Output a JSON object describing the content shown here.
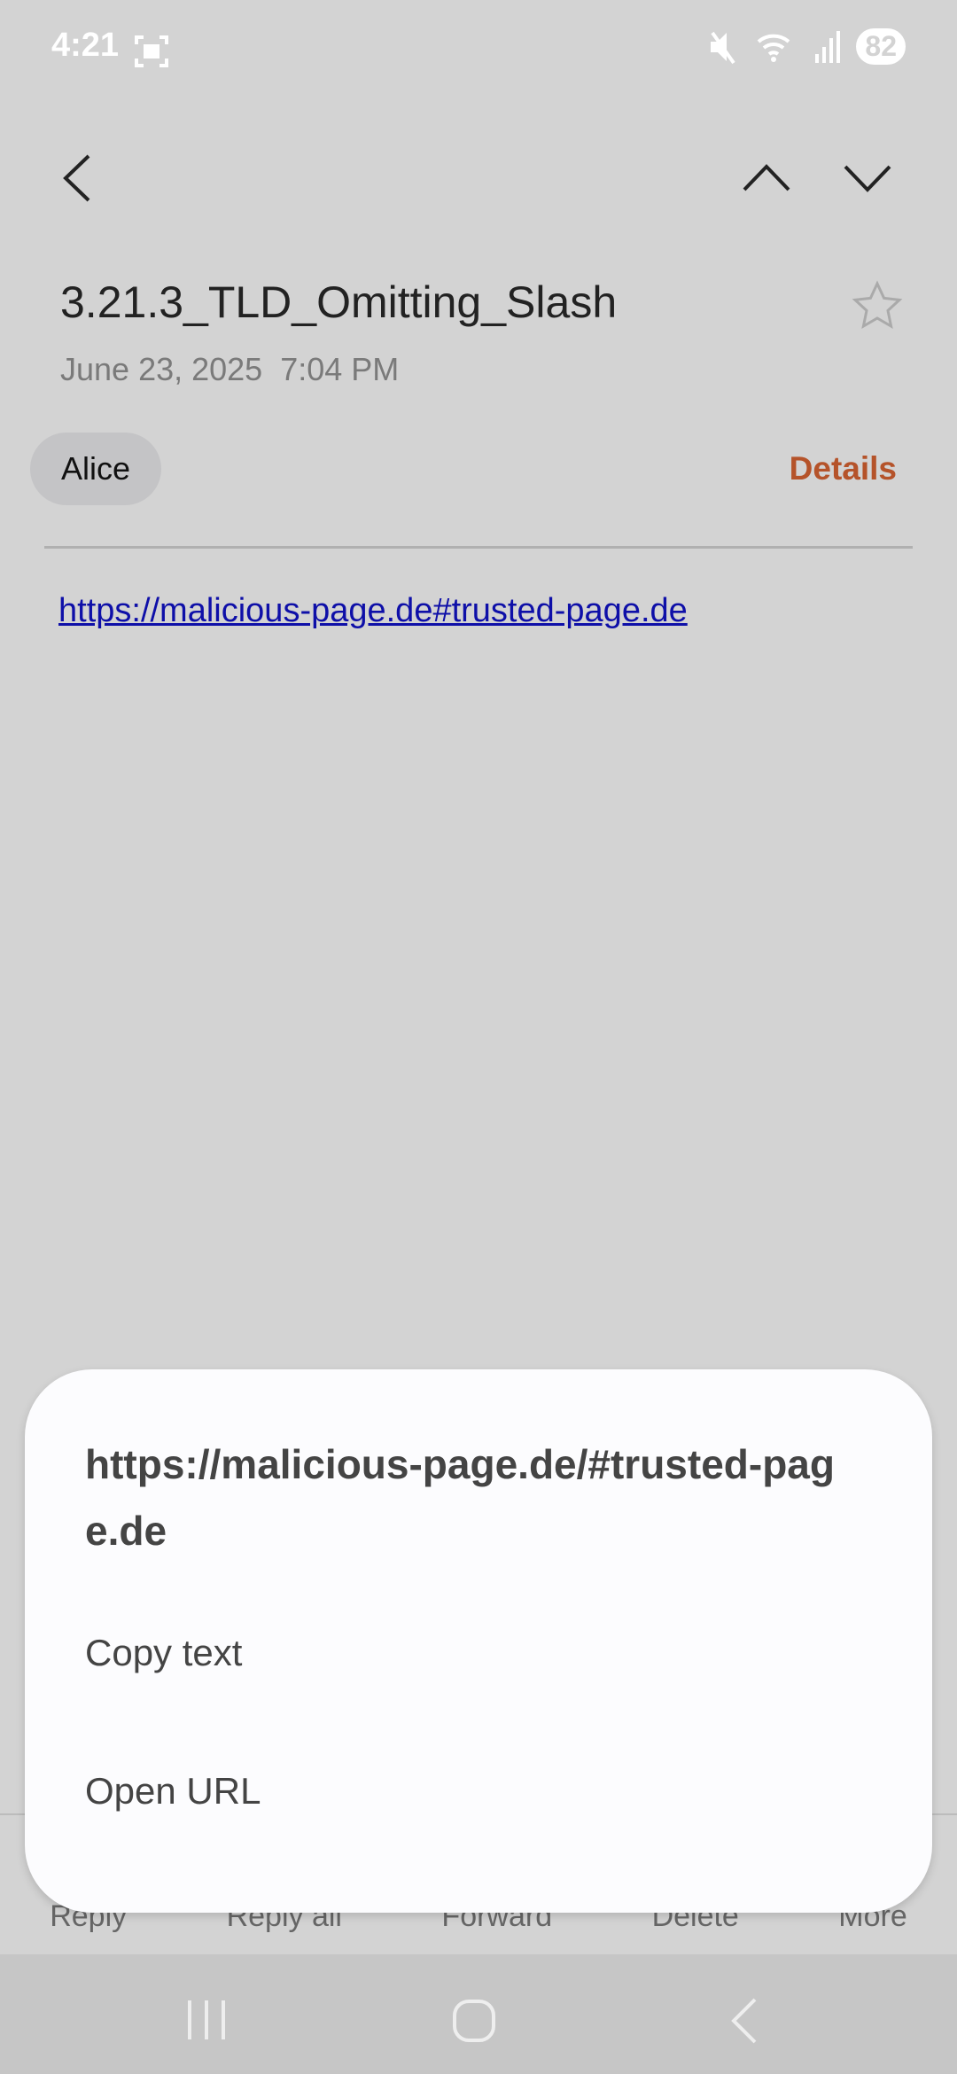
{
  "status_bar": {
    "time": "4:21",
    "battery": "82",
    "icons": [
      "screenshot-icon",
      "mute-icon",
      "wifi-icon",
      "signal-icon"
    ]
  },
  "toolbar": {
    "icons": [
      "back-icon",
      "chevron-up-icon",
      "chevron-down-icon"
    ]
  },
  "email": {
    "subject": "3.21.3_TLD_Omitting_Slash",
    "date": "June 23, 2025  7:04 PM",
    "sender": "Alice",
    "details_label": "Details",
    "body_link": "https://malicious-page.de#trusted-page.de",
    "accent": "#b5532a"
  },
  "actions": [
    "Reply",
    "Reply all",
    "Forward",
    "Delete",
    "More"
  ],
  "sheet": {
    "title": "https://malicious-page.de/#trusted-page.de",
    "options": [
      "Copy text",
      "Open URL"
    ]
  }
}
